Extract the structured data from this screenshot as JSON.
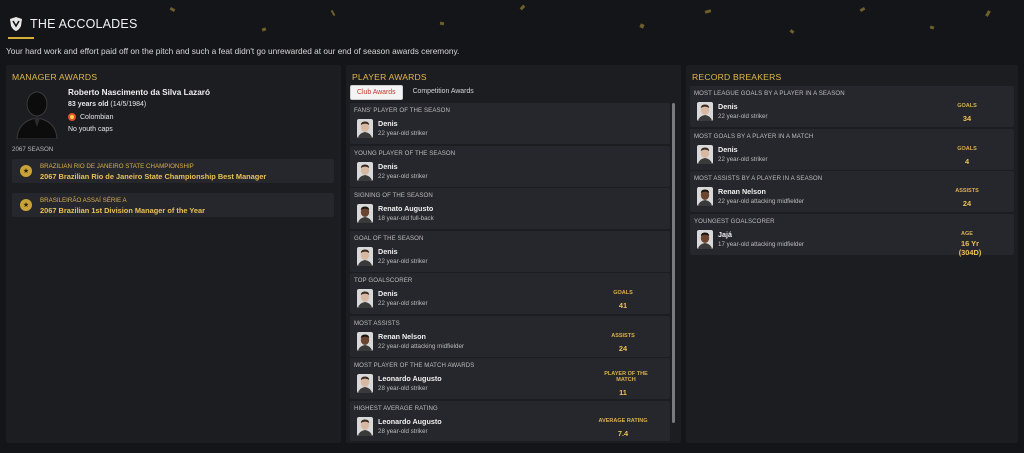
{
  "header": {
    "title": "THE ACCOLADES",
    "subtitle": "Your hard work and effort paid off on the pitch and such a feat didn't go unrewarded at our end of season awards ceremony."
  },
  "colors": {
    "accent": "#e0b84a",
    "gold": "#e9c154",
    "panel": "#1c1d21",
    "row": "#26272c",
    "active_tab_text": "#c0392b"
  },
  "manager_awards": {
    "title": "MANAGER AWARDS",
    "name": "Roberto Nascimento da Silva Lazaró",
    "age": "83 years old",
    "dob": "(14/5/1984)",
    "nationality": "Colombian",
    "caps": "No youth caps",
    "season": "2067 SEASON",
    "awards": [
      {
        "competition": "BRAZILIAN RIO DE JANEIRO STATE CHAMPIONSHIP",
        "award": "2067 Brazilian Rio de Janeiro State Championship Best Manager",
        "icon": "trophy-icon"
      },
      {
        "competition": "BRASILEIRÃO ASSAÍ SÉRIE A",
        "award": "2067 Brazilian 1st Division Manager of the Year",
        "icon": "trophy-icon"
      }
    ]
  },
  "player_awards": {
    "title": "PLAYER AWARDS",
    "tabs": [
      "Club Awards",
      "Competition Awards"
    ],
    "active_tab": "Club Awards",
    "items": [
      {
        "category": "FANS' PLAYER OF THE SEASON",
        "name": "Denis",
        "desc": "22 year-old striker",
        "stat_label": "",
        "stat_value": ""
      },
      {
        "category": "YOUNG PLAYER OF THE SEASON",
        "name": "Denis",
        "desc": "22 year-old striker",
        "stat_label": "",
        "stat_value": ""
      },
      {
        "category": "SIGNING OF THE SEASON",
        "name": "Renato Augusto",
        "desc": "18 year-old full-back",
        "stat_label": "",
        "stat_value": ""
      },
      {
        "category": "GOAL OF THE SEASON",
        "name": "Denis",
        "desc": "22 year-old striker",
        "stat_label": "",
        "stat_value": ""
      },
      {
        "category": "TOP GOALSCORER",
        "name": "Denis",
        "desc": "22 year-old striker",
        "stat_label": "GOALS",
        "stat_value": "41"
      },
      {
        "category": "MOST ASSISTS",
        "name": "Renan Nelson",
        "desc": "22 year-old attacking midfielder",
        "stat_label": "ASSISTS",
        "stat_value": "24"
      },
      {
        "category": "MOST PLAYER OF THE MATCH AWARDS",
        "name": "Leonardo Augusto",
        "desc": "28 year-old striker",
        "stat_label": "PLAYER OF THE MATCH",
        "stat_value": "11"
      },
      {
        "category": "HIGHEST AVERAGE RATING",
        "name": "Leonardo Augusto",
        "desc": "28 year-old striker",
        "stat_label": "AVERAGE RATING",
        "stat_value": "7.4"
      }
    ]
  },
  "record_breakers": {
    "title": "RECORD BREAKERS",
    "items": [
      {
        "category": "MOST LEAGUE GOALS BY A PLAYER IN A SEASON",
        "name": "Denis",
        "desc": "22 year-old striker",
        "stat_label": "GOALS",
        "stat_value": "34"
      },
      {
        "category": "MOST GOALS BY A PLAYER IN A MATCH",
        "name": "Denis",
        "desc": "22 year-old striker",
        "stat_label": "GOALS",
        "stat_value": "4"
      },
      {
        "category": "MOST ASSISTS BY A PLAYER IN A SEASON",
        "name": "Renan Nelson",
        "desc": "22 year-old attacking midfielder",
        "stat_label": "ASSISTS",
        "stat_value": "24"
      },
      {
        "category": "YOUNGEST GOALSCORER",
        "name": "Jajá",
        "desc": "17 year-old attacking midfielder",
        "stat_label": "AGE",
        "stat_value": "16 Yr (304D)"
      }
    ]
  }
}
